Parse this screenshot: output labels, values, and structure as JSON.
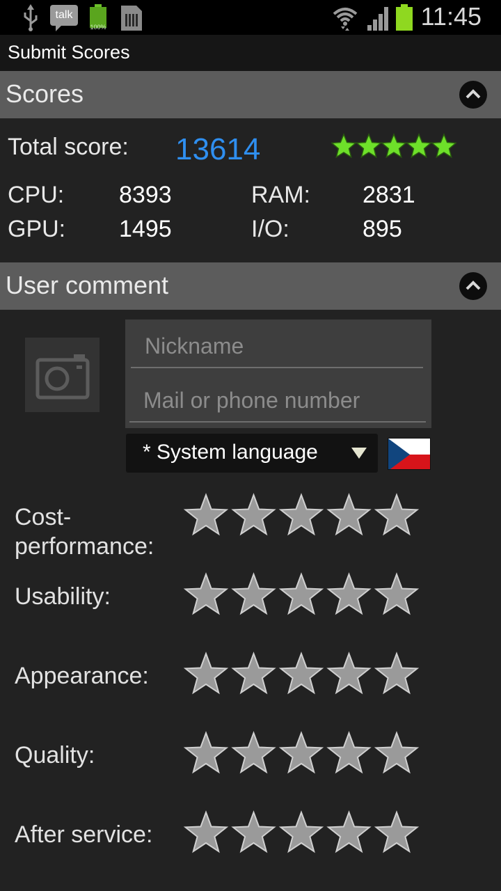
{
  "statusbar": {
    "talk_label": "talk",
    "battery_percent": "100%",
    "clock": "11:45",
    "icons": [
      "usb-icon",
      "talk-icon",
      "battery-full-icon",
      "sim-card-icon",
      "wifi-icon",
      "signal-icon",
      "battery-icon"
    ]
  },
  "titlebar": {
    "title": "Submit Scores"
  },
  "scores": {
    "header": "Scores",
    "total_label": "Total score:",
    "total_value": "13614",
    "total_rating": 5,
    "cpu_label": "CPU:",
    "cpu_value": "8393",
    "ram_label": "RAM:",
    "ram_value": "2831",
    "gpu_label": "GPU:",
    "gpu_value": "1495",
    "io_label": "I/O:",
    "io_value": "895"
  },
  "comment": {
    "header": "User comment",
    "nickname_placeholder": "Nickname",
    "nickname_value": "",
    "contact_placeholder": "Mail or phone number",
    "contact_value": "",
    "language_selected": "* System language",
    "flag": "czech-flag"
  },
  "ratings": [
    {
      "label_line1": "Cost-",
      "label_line2": "performance:",
      "value": 0
    },
    {
      "label_line1": "Usability:",
      "label_line2": "",
      "value": 0
    },
    {
      "label_line1": "Appearance:",
      "label_line2": "",
      "value": 0
    },
    {
      "label_line1": "Quality:",
      "label_line2": "",
      "value": 0
    },
    {
      "label_line1": "After service:",
      "label_line2": "",
      "value": 0
    }
  ],
  "colors": {
    "accent": "#2f8ff0",
    "star_green": "#6ee02a",
    "star_grey": "#9a9a9a",
    "section_header": "#5c5c5c"
  }
}
